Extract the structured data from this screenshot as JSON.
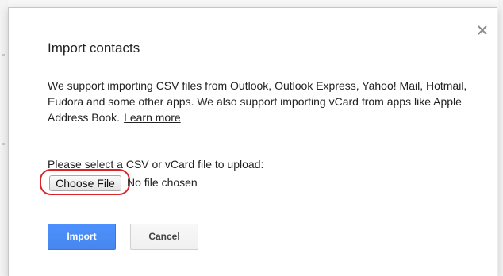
{
  "dialog": {
    "title": "Import contacts",
    "close_icon": "close-icon",
    "description": "We support importing CSV files from Outlook, Outlook Express, Yahoo! Mail, Hotmail, Eudora and some other apps. We also support importing vCard from apps like Apple Address Book.",
    "learn_more": "Learn more",
    "upload_prompt": "Please select a CSV or vCard file to upload:",
    "file_input": {
      "button_label": "Choose File",
      "status": "No file chosen"
    },
    "buttons": {
      "import": "Import",
      "cancel": "Cancel"
    }
  },
  "colors": {
    "primary_button": "#4d90fe",
    "highlight_ring": "#d9252a",
    "text": "#222222"
  }
}
